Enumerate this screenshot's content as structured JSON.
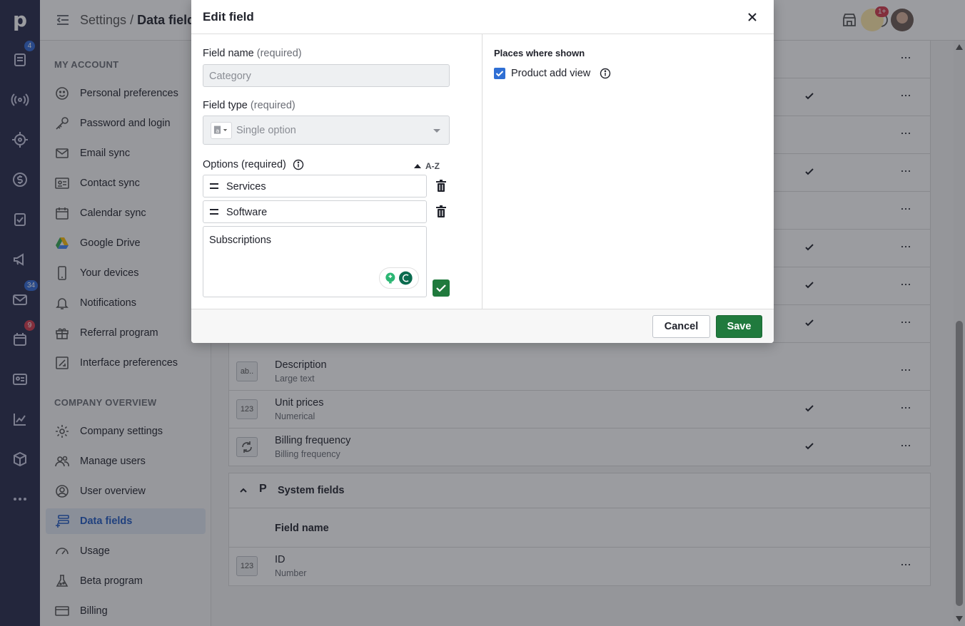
{
  "header": {
    "breadcrumb_parent": "Settings",
    "breadcrumb_separator": "/",
    "breadcrumb_current": "Data fields",
    "notification_badge": "1+"
  },
  "rail": {
    "logo": "p",
    "badges": {
      "deals": "4",
      "mail": "34",
      "activities": "9"
    }
  },
  "sidemenu": {
    "my_account_title": "MY ACCOUNT",
    "my_account": [
      {
        "label": "Personal preferences",
        "icon": "smiley-icon"
      },
      {
        "label": "Password and login",
        "icon": "key-icon"
      },
      {
        "label": "Email sync",
        "icon": "envelope-icon"
      },
      {
        "label": "Contact sync",
        "icon": "contact-card-icon"
      },
      {
        "label": "Calendar sync",
        "icon": "calendar-icon"
      },
      {
        "label": "Google Drive",
        "icon": "google-drive-icon"
      },
      {
        "label": "Your devices",
        "icon": "phone-icon"
      },
      {
        "label": "Notifications",
        "icon": "bell-icon"
      },
      {
        "label": "Referral program",
        "icon": "gift-icon"
      },
      {
        "label": "Interface preferences",
        "icon": "interface-icon"
      }
    ],
    "company_title": "COMPANY OVERVIEW",
    "company": [
      {
        "label": "Company settings",
        "icon": "gear-icon"
      },
      {
        "label": "Manage users",
        "icon": "users-icon"
      },
      {
        "label": "User overview",
        "icon": "user-circle-icon"
      },
      {
        "label": "Data fields",
        "icon": "data-fields-icon",
        "active": true
      },
      {
        "label": "Usage",
        "icon": "gauge-icon"
      },
      {
        "label": "Beta program",
        "icon": "flask-icon"
      },
      {
        "label": "Billing",
        "icon": "credit-card-icon"
      }
    ]
  },
  "fields": {
    "rows": [
      {
        "name": "Description",
        "type": "Large text",
        "type_icon": "ab..",
        "checked": false
      },
      {
        "name": "Unit prices",
        "type": "Numerical",
        "type_icon": "123",
        "checked": true
      },
      {
        "name": "Billing frequency",
        "type": "Billing frequency",
        "type_icon": "",
        "checked": true
      }
    ],
    "system_title": "System fields",
    "system_logo": "P",
    "column_header": "Field name",
    "system_rows": [
      {
        "name": "ID",
        "type": "Number",
        "type_icon": "123"
      }
    ]
  },
  "modal": {
    "title": "Edit field",
    "field_name_label": "Field name",
    "field_name_req": "(required)",
    "field_name_value": "Category",
    "field_type_label": "Field type",
    "field_type_req": "(required)",
    "field_type_value": "Single option",
    "options_label": "Options (required)",
    "sort_label": "A-Z",
    "options": [
      "Services",
      "Software"
    ],
    "new_option_value": "Subscriptions",
    "places_title": "Places where shown",
    "places": [
      {
        "label": "Product add view",
        "checked": true
      }
    ],
    "cancel_label": "Cancel",
    "save_label": "Save"
  },
  "colors": {
    "rail_bg": "#26284a",
    "accent_blue": "#2059c2",
    "save_green": "#207a3d",
    "badge_red": "#d3394b",
    "badge_blue": "#3168d6"
  }
}
